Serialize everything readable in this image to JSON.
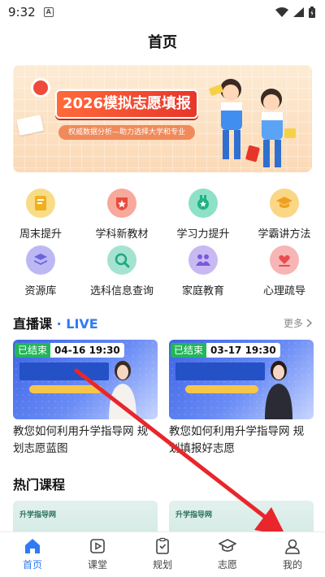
{
  "status_bar": {
    "time": "9:32",
    "notif_glyph": "A"
  },
  "header": {
    "title": "首页"
  },
  "banner": {
    "title": "2026模拟志愿填报",
    "subtitle": "权威数据分析—助力选择大学和专业"
  },
  "grid": [
    {
      "label": "周末提升",
      "icon": "notebook-icon",
      "color": "#f5c54a"
    },
    {
      "label": "学科新教材",
      "icon": "star-shield-icon",
      "color": "#ef6a5a"
    },
    {
      "label": "学习力提升",
      "icon": "medal-icon",
      "color": "#33c49a"
    },
    {
      "label": "学霸讲方法",
      "icon": "graduation-cap-icon",
      "color": "#f5b63a"
    },
    {
      "label": "资源库",
      "icon": "layers-icon",
      "color": "#7f7ae8"
    },
    {
      "label": "选科信息查询",
      "icon": "magnifier-icon",
      "color": "#3fbf9a"
    },
    {
      "label": "家庭教育",
      "icon": "family-icon",
      "color": "#8a6fe0"
    },
    {
      "label": "心理疏导",
      "icon": "heart-hand-icon",
      "color": "#f07070"
    }
  ],
  "live": {
    "title": "直播课",
    "dot": "·",
    "live_word": "LIVE",
    "more": "更多",
    "courses": [
      {
        "status": "已结束",
        "time": "04-16 19:30",
        "title": "教您如何利用升学指导网 规划志愿蓝图"
      },
      {
        "status": "已结束",
        "time": "03-17 19:30",
        "title": "教您如何利用升学指导网 规划填报好志愿"
      }
    ]
  },
  "hot": {
    "title": "热门课程",
    "logo_text": "升学指导网"
  },
  "nav": [
    {
      "label": "首页",
      "icon": "home-icon",
      "active": true
    },
    {
      "label": "课堂",
      "icon": "video-icon",
      "active": false
    },
    {
      "label": "规划",
      "icon": "clipboard-icon",
      "active": false
    },
    {
      "label": "志愿",
      "icon": "graduation-cap-icon",
      "active": false
    },
    {
      "label": "我的",
      "icon": "user-icon",
      "active": false
    }
  ],
  "colors": {
    "accent": "#2f7bf5",
    "arrow": "#e8262b",
    "badge_green": "#21b65a"
  }
}
